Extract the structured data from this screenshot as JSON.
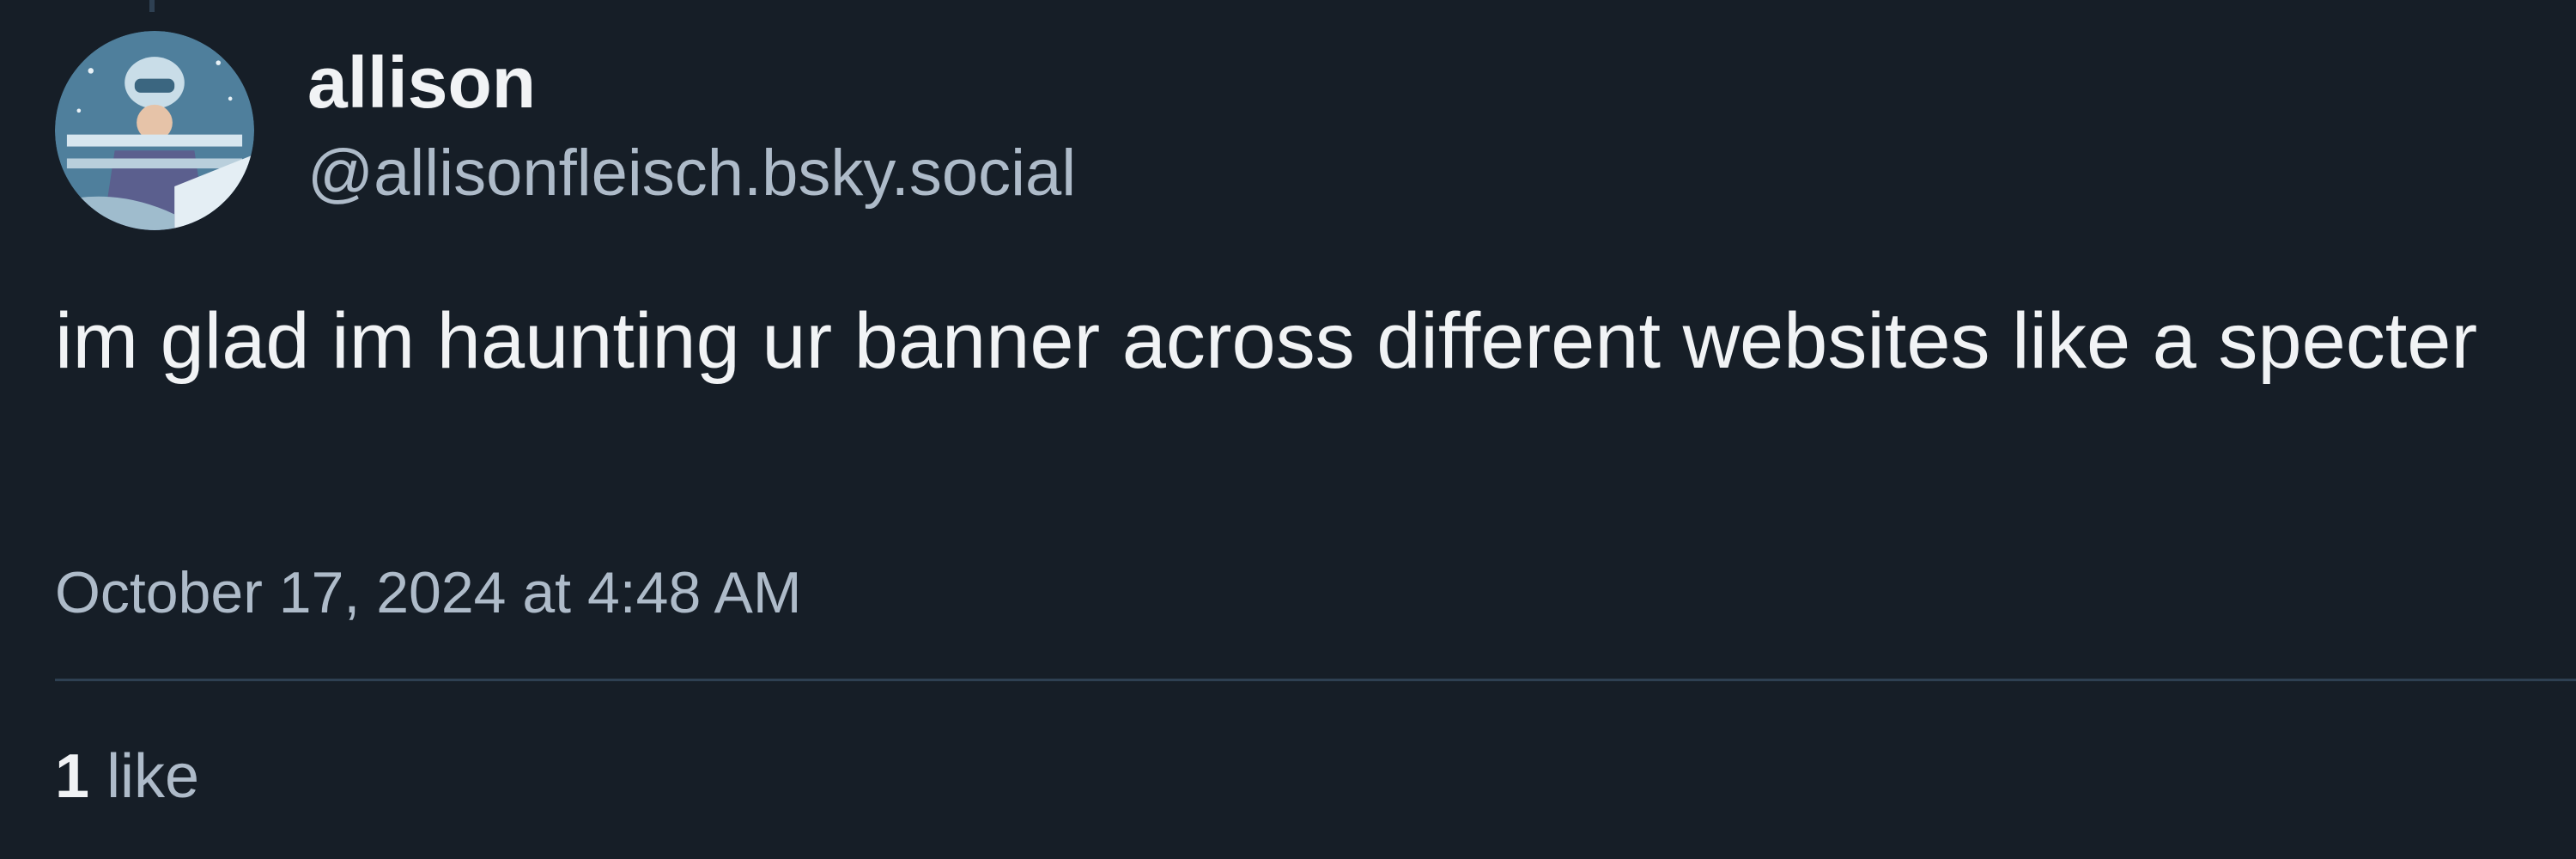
{
  "post": {
    "author": {
      "display_name": "allison",
      "handle": "@allisonfleisch.bsky.social",
      "avatar_icon": "user-avatar"
    },
    "text": "im glad im haunting ur banner across different websites like a specter",
    "timestamp": "October 17, 2024 at 4:48 AM",
    "stats": {
      "like_count": "1",
      "like_label": "like"
    }
  },
  "colors": {
    "background": "#161e27",
    "primary_text": "#f1f3f5",
    "secondary_text": "#aebbc9",
    "divider": "#2e4052"
  }
}
